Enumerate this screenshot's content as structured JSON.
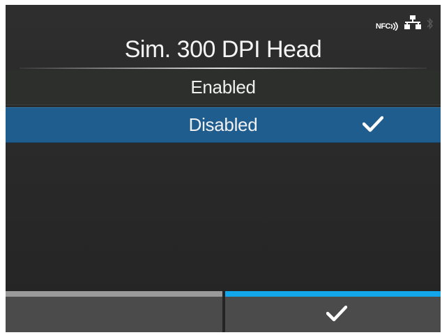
{
  "status": {
    "nfc_label": "NFC",
    "icons": [
      "nfc-icon",
      "network-icon",
      "bluetooth-icon"
    ]
  },
  "header": {
    "title": "Sim. 300 DPI Head"
  },
  "options": [
    {
      "label": "Enabled",
      "selected": false
    },
    {
      "label": "Disabled",
      "selected": true
    }
  ],
  "softkeys": {
    "left": {
      "label": "",
      "bar_color": "#9a9a9a"
    },
    "right": {
      "icon": "checkmark-icon",
      "bar_color": "#12a7ea"
    }
  },
  "colors": {
    "selection": "#1f5d8e",
    "accent": "#12a7ea",
    "background": "#2a2a2a"
  }
}
